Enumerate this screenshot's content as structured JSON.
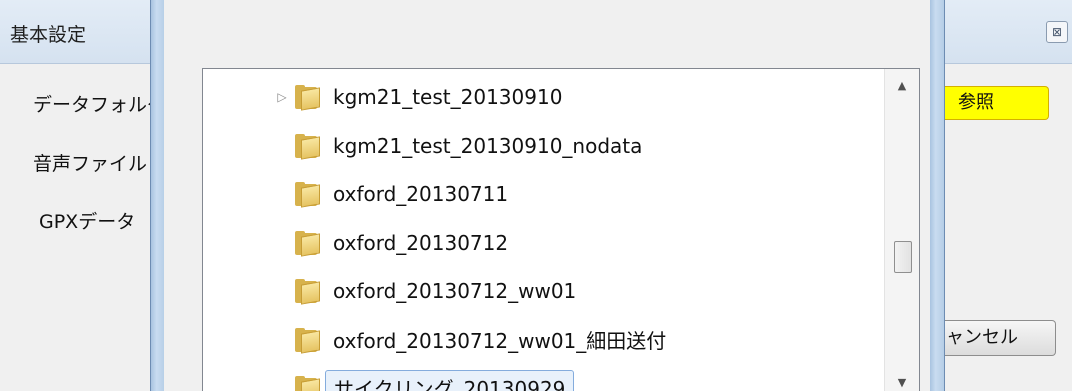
{
  "background_dialog": {
    "title": "基本設定",
    "labels": [
      "データフォルダ",
      "音声ファイル",
      "GPXデータ"
    ],
    "browse_button": "参照",
    "cancel_button": "キャンセル",
    "close_icon": "close-icon"
  },
  "folder_tree": {
    "items": [
      {
        "name": "kgm21_test_20130910",
        "has_children": true,
        "selected": false
      },
      {
        "name": "kgm21_test_20130910_nodata",
        "has_children": false,
        "selected": false
      },
      {
        "name": "oxford_20130711",
        "has_children": false,
        "selected": false
      },
      {
        "name": "oxford_20130712",
        "has_children": false,
        "selected": false
      },
      {
        "name": "oxford_20130712_ww01",
        "has_children": false,
        "selected": false
      },
      {
        "name": "oxford_20130712_ww01_細田送付",
        "has_children": false,
        "selected": false
      },
      {
        "name": "サイクリング_20130929",
        "has_children": false,
        "selected": true
      }
    ],
    "icons": {
      "expander": "expand-arrow-icon",
      "folder": "folder-icon"
    },
    "scrollbar": {
      "up": "▲",
      "down": "▼"
    }
  },
  "colors": {
    "browse_button": "#ffff00",
    "selection": "#e8f1fb",
    "frame": "#b5cde6"
  }
}
